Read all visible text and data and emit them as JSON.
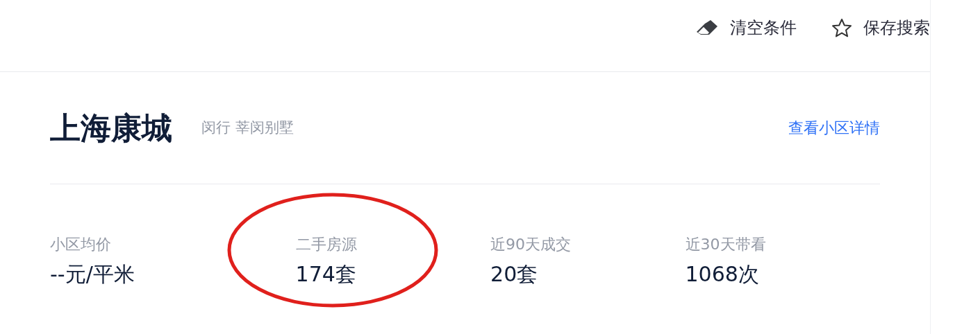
{
  "toolbar": [
    {
      "kind": "clear",
      "label": "清空条件"
    },
    {
      "kind": "save",
      "label": "保存搜索"
    }
  ],
  "community": {
    "name": "上海康城",
    "location": "闵行 莘闵别墅",
    "detail_link": "查看小区详情"
  },
  "stats": [
    {
      "label": "小区均价",
      "value": "--元/平米",
      "highlighted": false
    },
    {
      "label": "二手房源",
      "value": "174套",
      "highlighted": true
    },
    {
      "label": "近90天成交",
      "value": "20套",
      "highlighted": false
    },
    {
      "label": "近30天带看",
      "value": "1068次",
      "highlighted": false
    }
  ]
}
